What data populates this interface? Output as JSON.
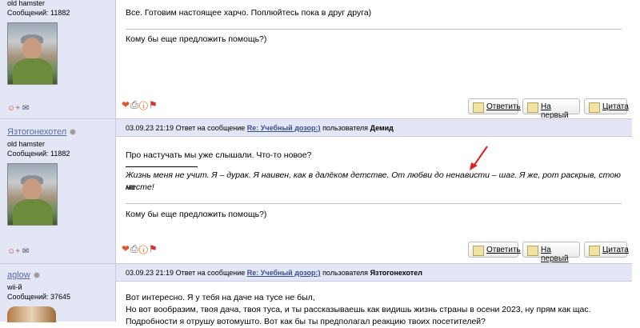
{
  "posts": [
    {
      "user": {
        "name": "",
        "title": "old hamster",
        "messages": "Сообщений: 11882"
      },
      "text": [
        "Все. Готовим настоящее харчо. Поплюйтесь пока в друг друга)"
      ],
      "signature": "Кому бы еще предложить помощь?)",
      "buttons": {
        "reply": "Ответить",
        "top": "На первый",
        "quote": "Цитата"
      }
    },
    {
      "user": {
        "name": "Язтогонехотел",
        "title": "old hamster",
        "messages": "Сообщений: 11882"
      },
      "header": {
        "date": "03.09.23 21:19",
        "answer_prefix": "Ответ на сообщение",
        "topic": "Re: Учебный дозор:)",
        "user_prefix": "пользователя",
        "to": "Демид"
      },
      "quote": "Про настучать мы уже слышали. Что-то новое?",
      "text": [
        "Жизнь меня не учит. Я – дурак. Я наивен, как в далёком детстве. От любви до ненависти – шаг. Я же, рот раскрыв, стою на",
        "месте!"
      ],
      "signature": "Кому бы еще предложить помощь?)",
      "buttons": {
        "reply": "Ответить",
        "top": "На первый",
        "quote": "Цитата"
      }
    },
    {
      "user": {
        "name": "aglow",
        "title": "wii-й",
        "messages": "Сообщений: 37645"
      },
      "header": {
        "date": "03.09.23 21:19",
        "answer_prefix": "Ответ на сообщение",
        "topic": "Re: Учебный дозор:)",
        "user_prefix": "пользователя",
        "to": "Язтогонехотел"
      },
      "text": [
        "Вот интересно. Я у тебя на даче на тусе не был,",
        "Но вот вообразим, твоя дача, твоя туса, и ты рассказываешь как видишь жизнь страны в осени 2023, ну прям как щас.",
        "Подробности я отрушу вотомушто. Вот как бы ты предполагал реакцию твоих посетителей?"
      ]
    }
  ],
  "colors": {
    "sidebar": "#e3e6f5",
    "border": "#c6cbe3",
    "link": "#3a4f8a",
    "arrow": "#e02020"
  }
}
